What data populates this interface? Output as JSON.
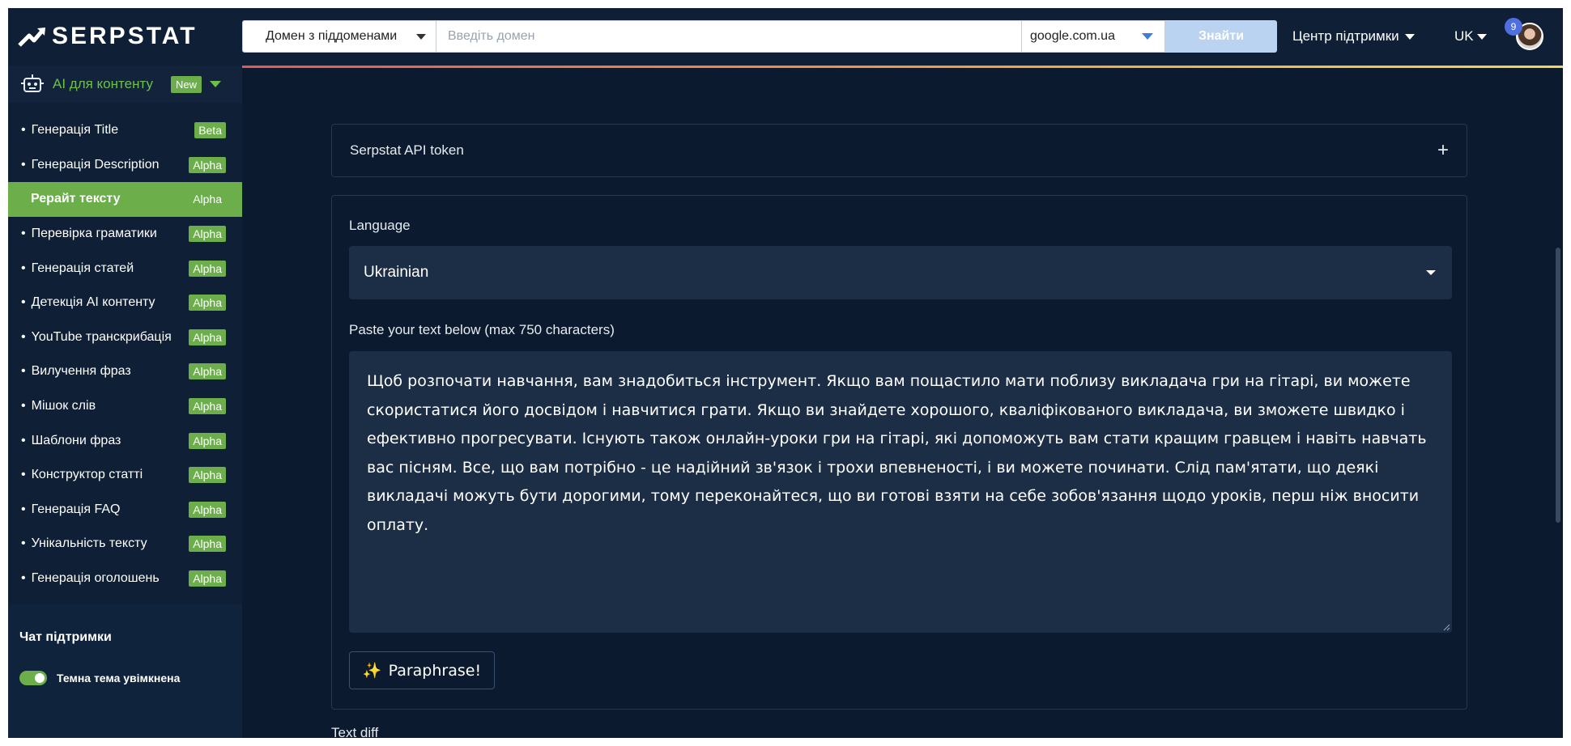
{
  "header": {
    "logo_text": "SERPSTAT",
    "scope_select": "Домен з піддоменами",
    "domain_placeholder": "Введіть домен",
    "search_engine": "google.com.ua",
    "find_button": "Знайти",
    "support_menu": "Центр підтримки",
    "language": "UK",
    "notifications_count": "9"
  },
  "sidebar": {
    "module_title": "AI для контенту",
    "module_badge": "New",
    "items": [
      {
        "label": "Генерація Title",
        "badge": "Beta"
      },
      {
        "label": "Генерація Description",
        "badge": "Alpha"
      },
      {
        "label": "Рерайт тексту",
        "badge": "Alpha"
      },
      {
        "label": "Перевірка граматики",
        "badge": "Alpha"
      },
      {
        "label": "Генерація статей",
        "badge": "Alpha"
      },
      {
        "label": "Детекція AI контенту",
        "badge": "Alpha"
      },
      {
        "label": "YouTube транскрибація",
        "badge": "Alpha"
      },
      {
        "label": "Вилучення фраз",
        "badge": "Alpha"
      },
      {
        "label": "Мішок слів",
        "badge": "Alpha"
      },
      {
        "label": "Шаблони фраз",
        "badge": "Alpha"
      },
      {
        "label": "Конструктор статті",
        "badge": "Alpha"
      },
      {
        "label": "Генерація FAQ",
        "badge": "Alpha"
      },
      {
        "label": "Унікальність тексту",
        "badge": "Alpha"
      },
      {
        "label": "Генерація оголошень",
        "badge": "Alpha"
      }
    ],
    "active_index": 2,
    "support_chat": "Чат підтримки",
    "dark_theme_label": "Темна тема увімкнена",
    "dark_theme_enabled": true
  },
  "main": {
    "api_token_title": "Serpstat API token",
    "language_label": "Language",
    "language_value": "Ukrainian",
    "text_label": "Paste your text below (max 750 characters)",
    "text_value": "Щоб розпочати навчання, вам знадобиться інструмент. Якщо вам пощастило мати поблизу викладача гри на гітарі, ви можете скористатися його досвідом і навчитися грати. Якщо ви знайдете хорошого, кваліфікованого викладача, ви зможете швидко і ефективно прогресувати. Існують також онлайн-уроки гри на гітарі, які допоможуть вам стати кращим гравцем і навіть навчать вас пісням. Все, що вам потрібно - це надійний зв'язок і трохи впевненості, і ви можете починати. Слід пам'ятати, що деякі викладачі можуть бути дорогими, тому переконайтеся, що ви готові взяти на себе зобов'язання щодо уроків, перш ніж вносити оплату.",
    "paraphrase_button": "Paraphrase!",
    "diff_title": "Text diff"
  },
  "colors": {
    "accent_green": "#6bae4a",
    "background": "#0b1a2e",
    "panel": "#1c2d46",
    "find_button": "#b9d3f1"
  }
}
